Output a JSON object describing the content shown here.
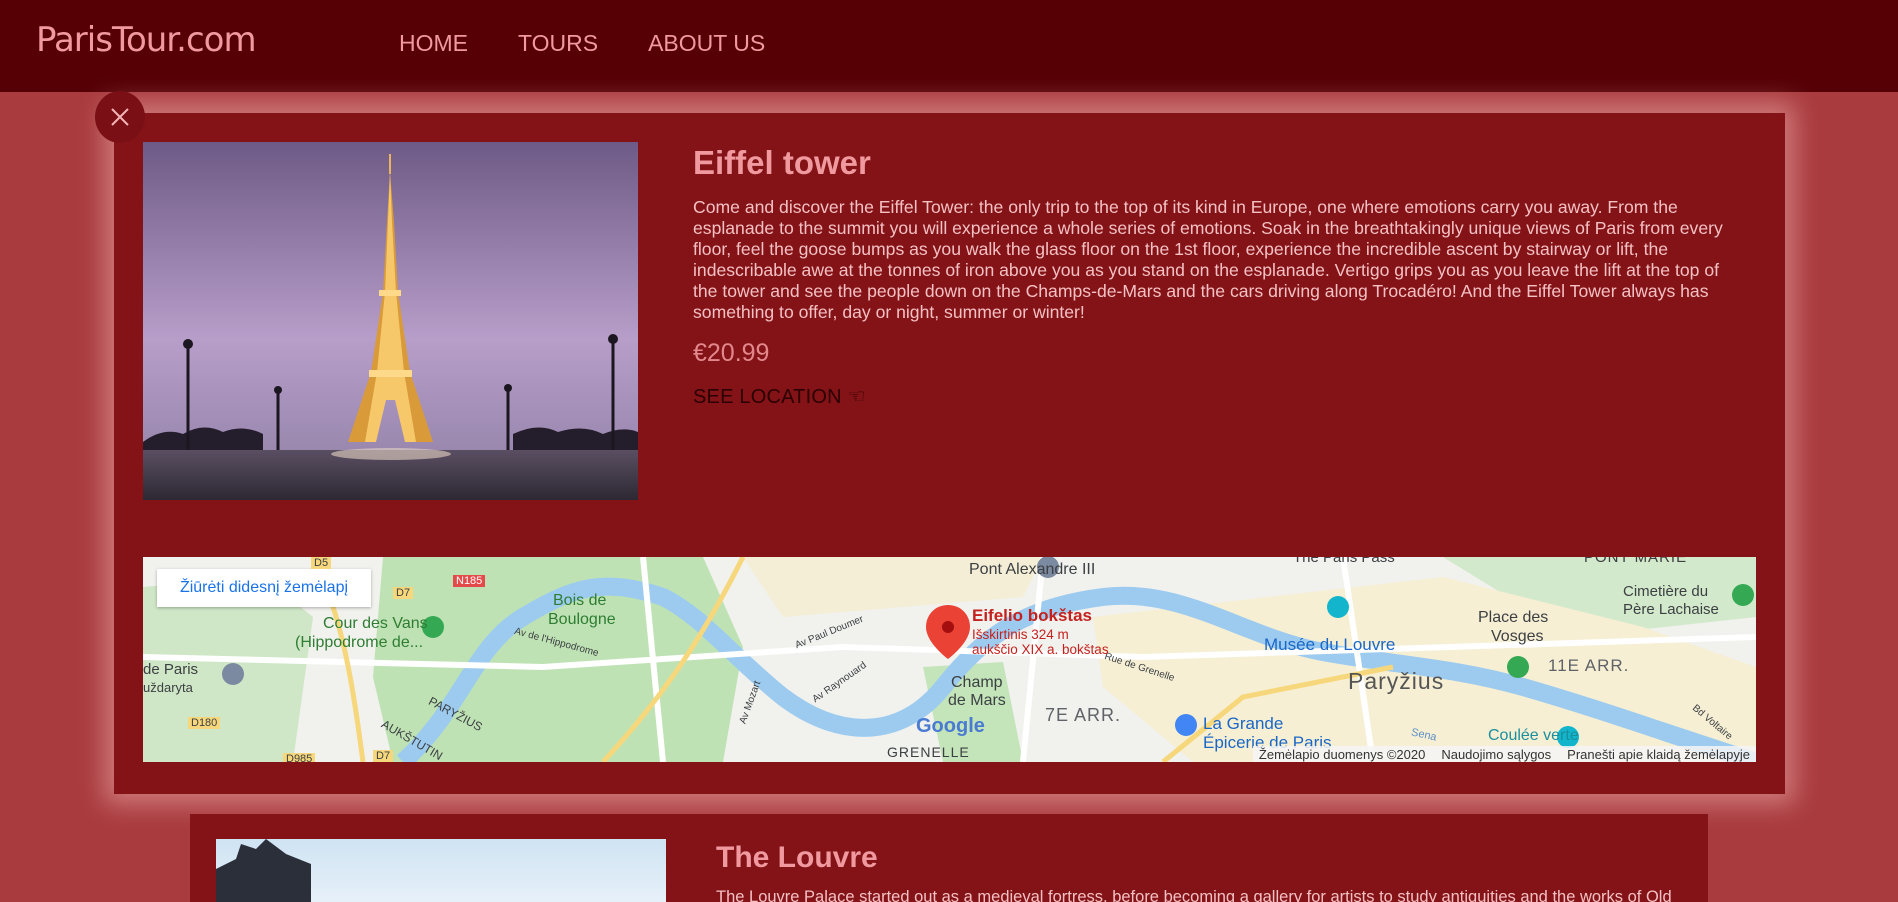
{
  "header": {
    "logo": "ParisTour.com",
    "nav": [
      {
        "label": "HOME"
      },
      {
        "label": "TOURS"
      },
      {
        "label": "ABOUT US"
      }
    ]
  },
  "detail": {
    "title": "Eiffel tower",
    "description": "Come and discover the Eiffel Tower: the only trip to the top of its kind in Europe, one where emotions carry you away. From the esplanade to the summit you will experience a whole series of emotions. Soak in the breathtakingly unique views of Paris from every floor, feel the goose bumps as you walk the glass floor on the 1st floor, experience the incredible ascent by stairway or lift, the indescribable awe at the tonnes of iron above you as you stand on the esplanade. Vertigo grips you as you leave the lift at the top of the tower and see the people down on the Champs-de-Mars and the cars driving along Trocadéro! And the Eiffel Tower always has something to offer, day or night, summer or winter!",
    "price": "€20.99",
    "see_location": "SEE LOCATION ☜"
  },
  "map": {
    "view_larger": "Žiūrėti didesnį žemėlapį",
    "pin_title": "Eifelio bokštas",
    "pin_sub1": "Išskirtinis 324 m",
    "pin_sub2": "aukščio XIX a. bokštas",
    "labels": {
      "pont": "Pont Alexandre III",
      "paris_pass": "The Paris Pass",
      "pont_marie": "PONT MARIE",
      "cimetiere1": "Cimetière du",
      "cimetiere2": "Père Lachaise",
      "bois1": "Bois de",
      "bois2": "Boulogne",
      "cour1": "Cour des Vans",
      "cour2": "(Hippodrome de...",
      "de_paris": "de Paris",
      "uzdaryta": "uždaryta",
      "d5": "D5",
      "d7": "D7",
      "d7b": "D7",
      "n185": "N185",
      "d180": "D180",
      "d985": "D985",
      "musee": "Musée du Louvre",
      "place1": "Place des",
      "place2": "Vosges",
      "arr11": "11E ARR.",
      "paryzius": "Paryžius",
      "arr7": "7E ARR.",
      "champ1": "Champ",
      "champ2": "de Mars",
      "grande1": "La Grande",
      "grande2": "Épicerie de Paris",
      "coulee": "Coulée verte",
      "grenelle": "GRENELLE",
      "paryzius_small": "PARYŽIUS",
      "aukstutin": "AUKŠTUTIN",
      "av_paul": "Av Paul Doumer",
      "av_hippo": "Av de l'Hippodrome",
      "av_raynouard": "Av Raynouard",
      "av_mozart": "Av Mozart",
      "rue_grenelle": "Rue de Grenelle",
      "bd_voltaire": "Bd Voltaire",
      "seine": "Sena"
    },
    "google": "Google",
    "footer": [
      "Žemėlapio duomenys ©2020",
      "Naudojimo sąlygos",
      "Pranešti apie klaidą žemėlapyje"
    ]
  },
  "next_card": {
    "title": "The Louvre",
    "description": "The Louvre Palace started out as a medieval fortress, before becoming a gallery for artists to study antiquities and the works of Old"
  },
  "colors": {
    "header_bg": "#560005",
    "page_bg": "#a93b3e",
    "card_bg": "#841317",
    "accent": "#f09aa0"
  }
}
